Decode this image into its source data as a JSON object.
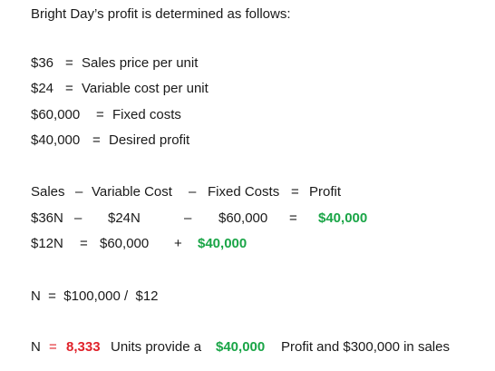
{
  "heading": "Bright Day’s profit is determined as follows:",
  "givens": [
    {
      "value": "$36",
      "sep": "=",
      "label": "Sales price per unit"
    },
    {
      "value": "$24",
      "sep": "=",
      "label": "Variable cost per unit"
    },
    {
      "value": "$60,000",
      "sep": "=",
      "label": "Fixed costs"
    },
    {
      "value": "$40,000",
      "sep": "=",
      "label": "Desired profit"
    }
  ],
  "equation": {
    "terms": [
      "Sales",
      "–",
      "Variable Cost",
      "–",
      "Fixed Costs",
      "=",
      "Profit"
    ]
  },
  "row1": {
    "a": "$36N",
    "m1": "–",
    "b": "$24N",
    "m2": "–",
    "c": "$60,000",
    "eq": "=",
    "profit": "$40,000"
  },
  "row2": {
    "a": "$12N",
    "eq": "=",
    "b": "$60,000",
    "plus": "+",
    "profit": "$40,000"
  },
  "row3": {
    "text": "N  =  $100,000 /  $12"
  },
  "conclusion": {
    "prefix": "N",
    "eq": "=",
    "units": "8,333",
    "mid": "Units provide a",
    "profit": "$40,000",
    "tail": "Profit and $300,000 in sales"
  },
  "colors": {
    "green": "#1aa547",
    "red": "#e0222a"
  }
}
